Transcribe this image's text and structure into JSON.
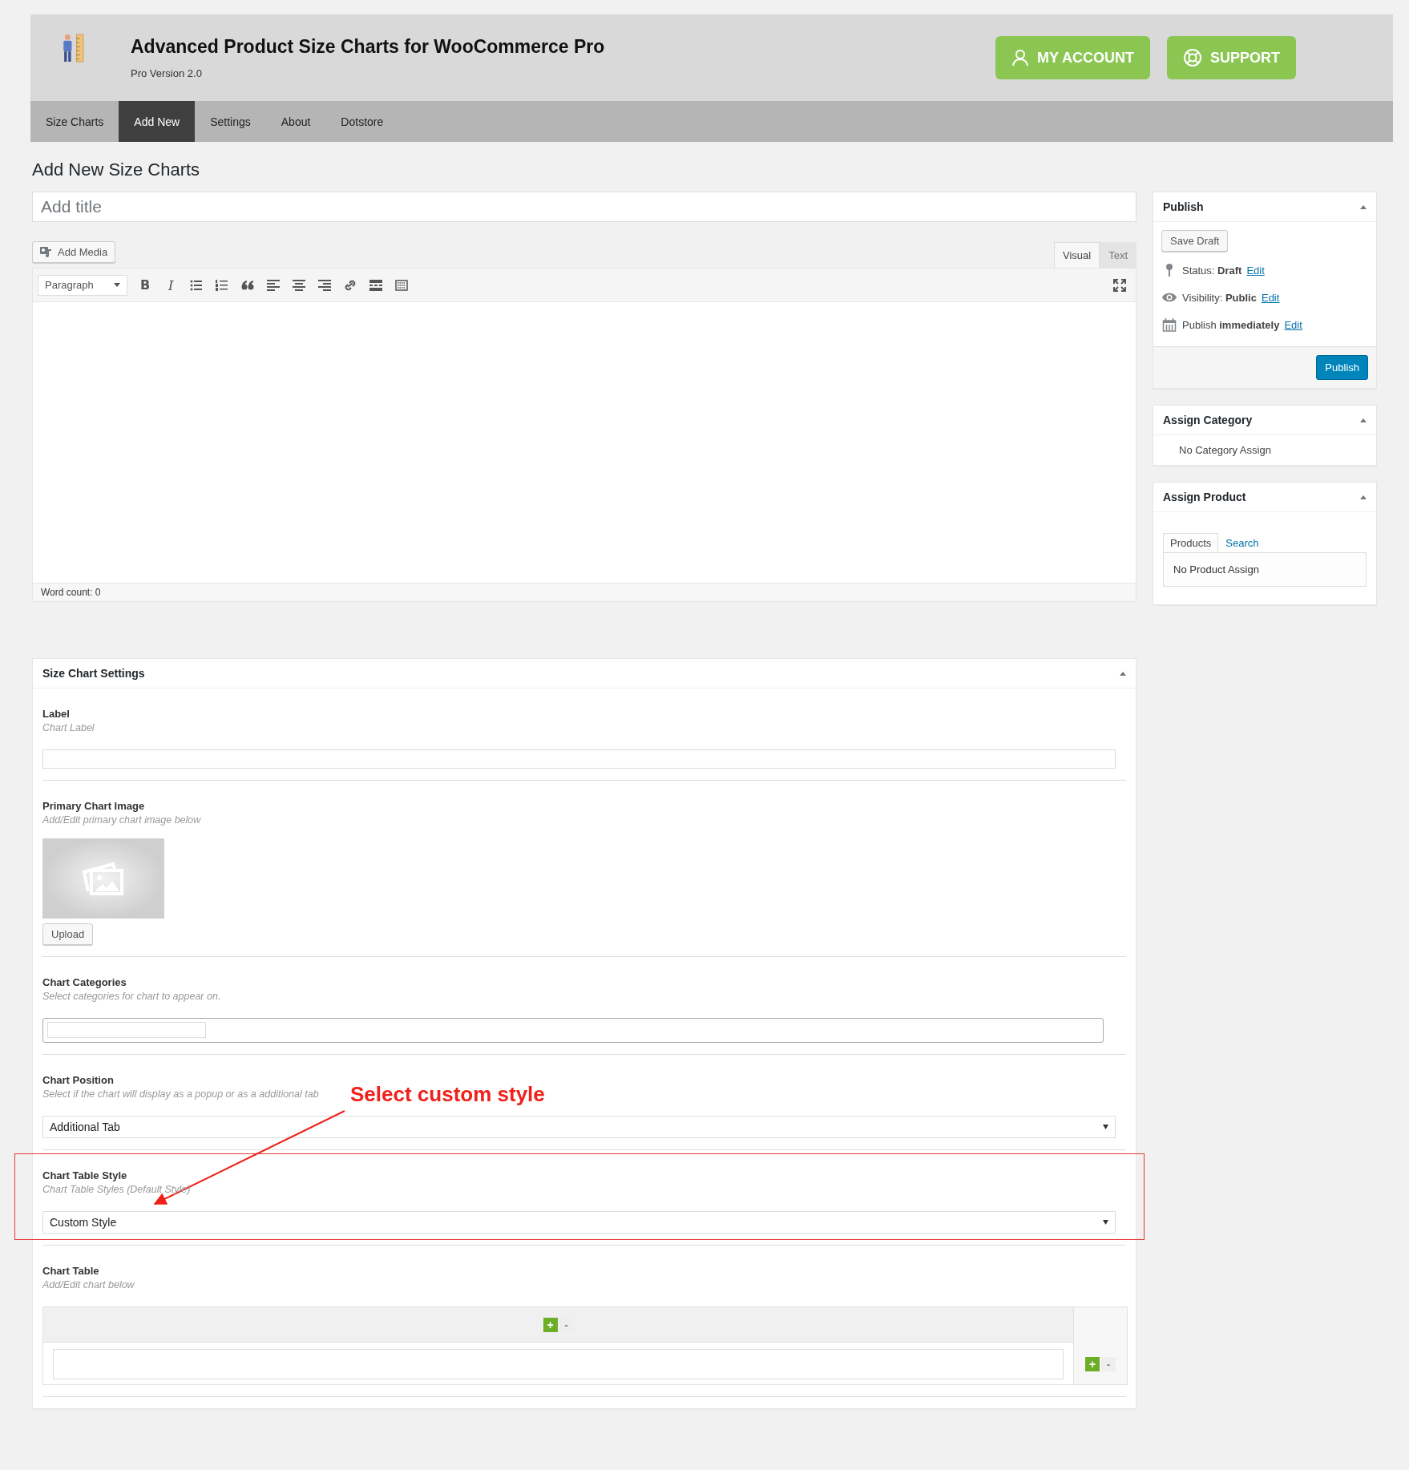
{
  "header": {
    "title": "Advanced Product Size Charts for WooCommerce Pro",
    "version": "Pro Version 2.0",
    "buttons": [
      {
        "label": "MY ACCOUNT",
        "kind": "account"
      },
      {
        "label": "SUPPORT",
        "kind": "support"
      }
    ]
  },
  "nav": [
    {
      "label": "Size Charts",
      "selected": false
    },
    {
      "label": "Add New",
      "selected": true
    },
    {
      "label": "Settings",
      "selected": false
    },
    {
      "label": "About",
      "selected": false
    },
    {
      "label": "Dotstore",
      "selected": false
    }
  ],
  "page_title": "Add New Size Charts",
  "title_field": {
    "placeholder": "Add title"
  },
  "editor": {
    "add_media": "Add Media",
    "tabs": [
      {
        "label": "Visual",
        "selected": true
      },
      {
        "label": "Text",
        "selected": false
      }
    ],
    "format": "Paragraph",
    "toolbar": [
      {
        "kind": "bold",
        "glyph": "B"
      },
      {
        "kind": "italic",
        "glyph": "I"
      },
      {
        "kind": "bullets"
      },
      {
        "kind": "numbers"
      },
      {
        "kind": "quote"
      },
      {
        "kind": "align-left"
      },
      {
        "kind": "align-center"
      },
      {
        "kind": "align-right"
      },
      {
        "kind": "link"
      },
      {
        "kind": "more"
      },
      {
        "kind": "toolbar-toggle"
      }
    ],
    "word_count": "Word count: 0"
  },
  "settings": {
    "title": "Size Chart Settings",
    "fields": [
      {
        "kind": "text",
        "label": "Label",
        "hint": "Chart Label",
        "highlighted": false
      },
      {
        "kind": "image",
        "label": "Primary Chart Image",
        "hint": "Add/Edit primary chart image below",
        "button": "Upload",
        "highlighted": false
      },
      {
        "kind": "tags",
        "label": "Chart Categories",
        "hint": "Select categories for chart to appear on.",
        "highlighted": false
      },
      {
        "kind": "select",
        "label": "Chart Position",
        "hint": "Select if the chart will display as a popup or as a additional tab",
        "value": "Additional Tab",
        "highlighted": false
      },
      {
        "kind": "select",
        "label": "Chart Table Style",
        "hint": "Chart Table Styles (Default Style)",
        "value": "Custom Style",
        "highlighted": true
      },
      {
        "kind": "table",
        "label": "Chart Table",
        "hint": "Add/Edit chart below",
        "column_controls": [
          {
            "label": "+",
            "enabled": true
          },
          {
            "label": "-",
            "enabled": false
          }
        ],
        "row_controls": [
          {
            "label": "+",
            "enabled": true
          },
          {
            "label": "-",
            "enabled": false
          }
        ],
        "highlighted": false
      }
    ]
  },
  "annotation": {
    "text": "Select custom style"
  },
  "sidebar": {
    "publish": {
      "title": "Publish",
      "save_draft": "Save Draft",
      "rows": [
        {
          "kind": "status",
          "text": "Status: **Draft**",
          "link": "Edit"
        },
        {
          "kind": "visibility",
          "text": "Visibility: **Public**",
          "link": "Edit"
        },
        {
          "kind": "schedule",
          "text": "Publish **immediately**",
          "link": "Edit"
        }
      ],
      "button": "Publish"
    },
    "category": {
      "title": "Assign Category",
      "empty": "No Category Assign"
    },
    "product": {
      "title": "Assign Product",
      "tabs": [
        {
          "label": "Products",
          "selected": true
        },
        {
          "label": "Search",
          "selected": false
        }
      ],
      "empty": "No Product Assign"
    }
  }
}
